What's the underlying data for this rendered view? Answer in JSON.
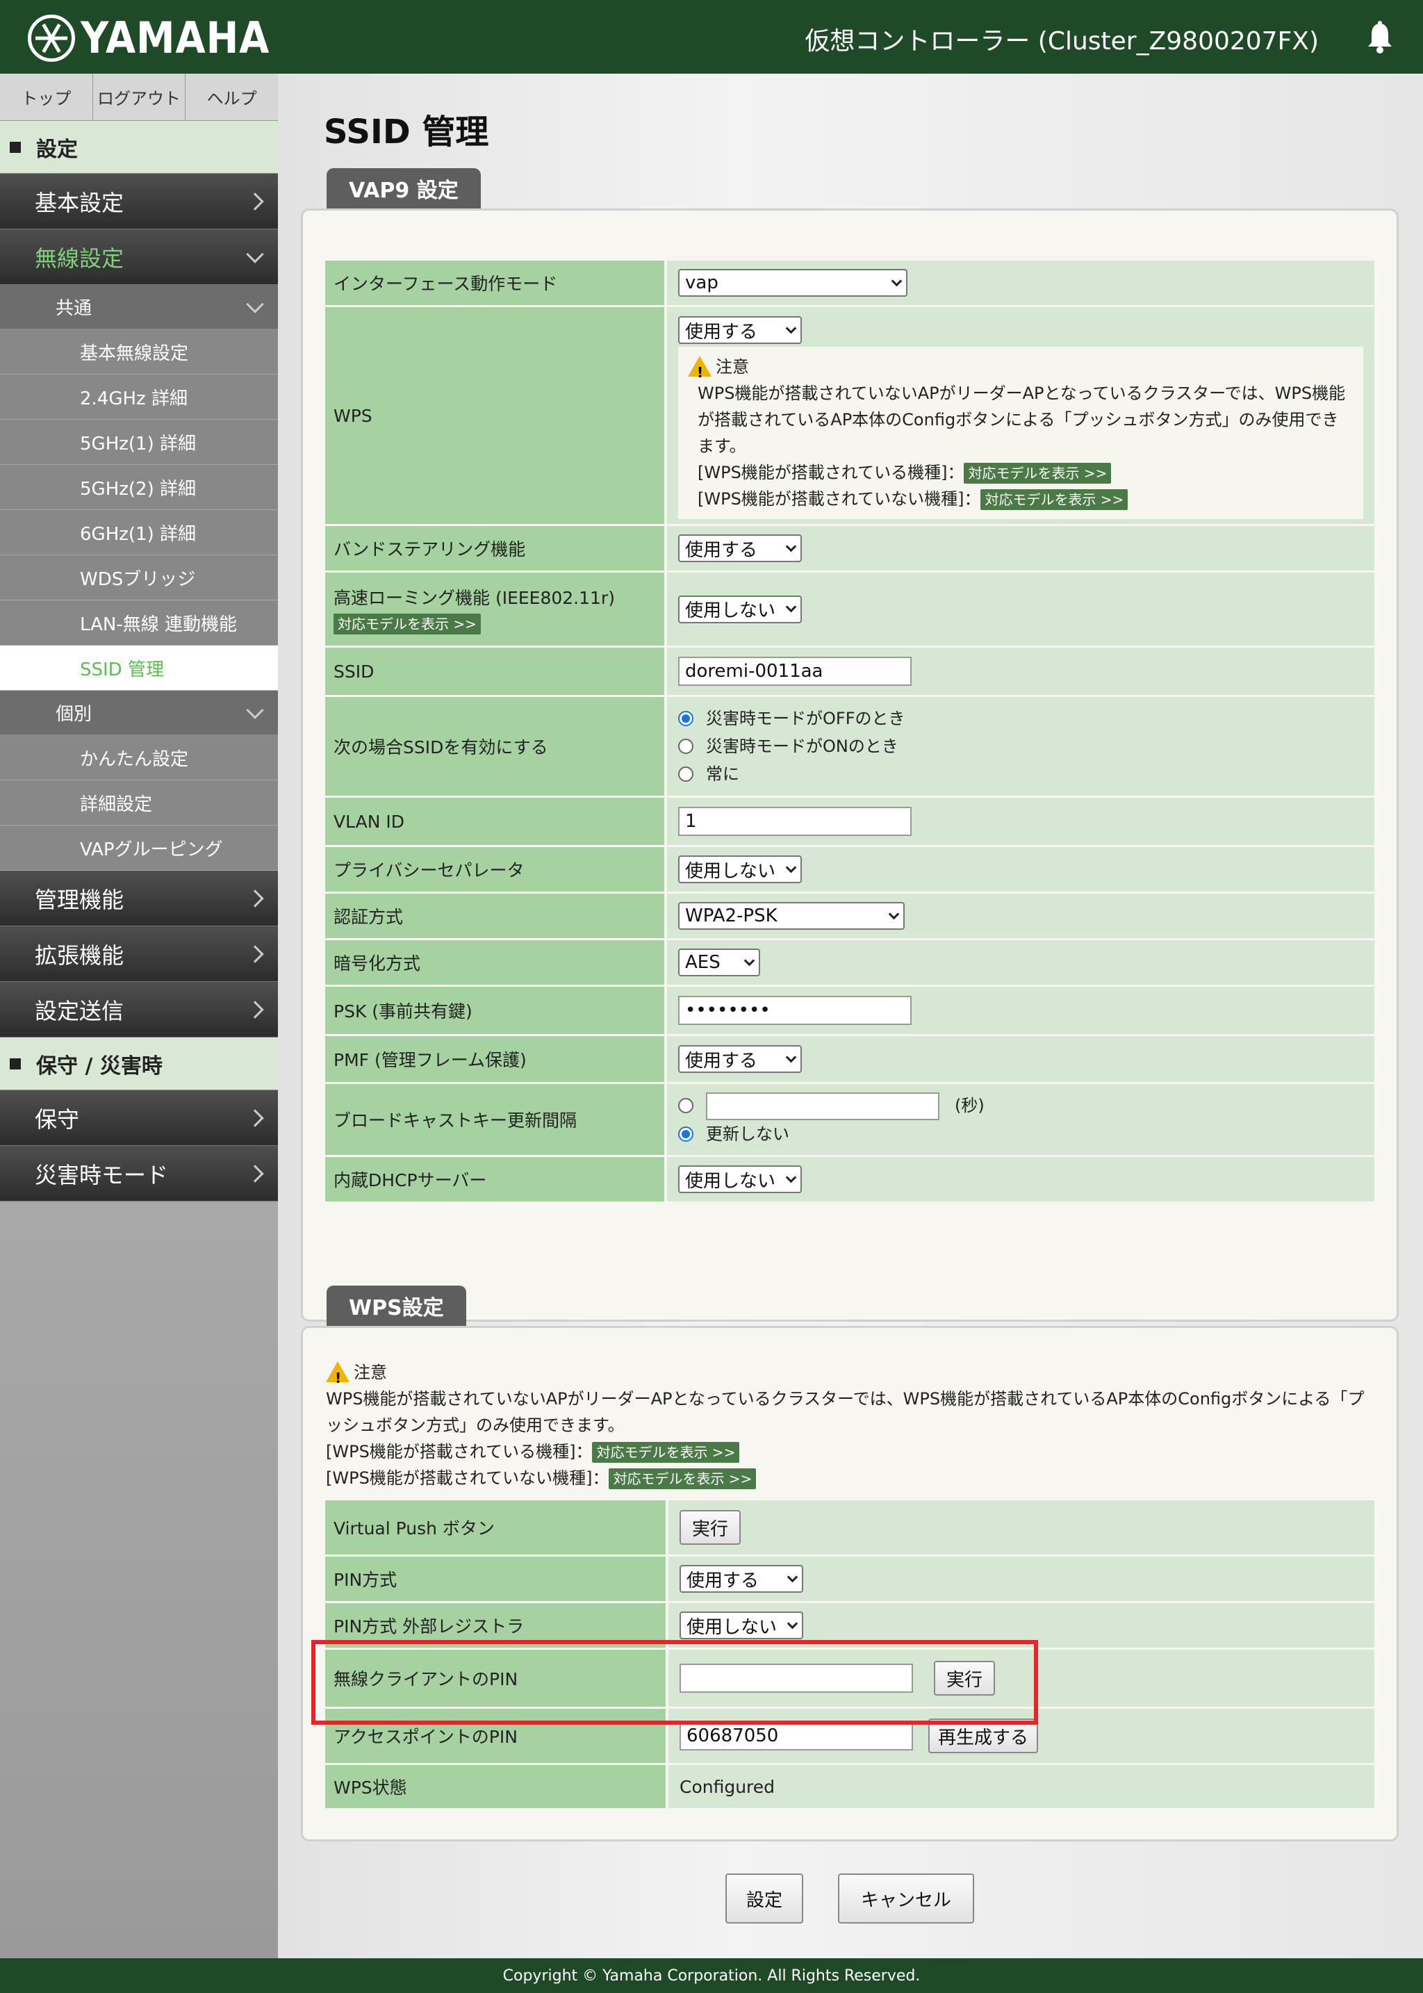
{
  "header": {
    "brand": "YAMAHA",
    "title": "仮想コントローラー (Cluster_Z9800207FX)"
  },
  "topnav": [
    "トップ",
    "ログアウト",
    "ヘルプ"
  ],
  "sidebar": {
    "section_settings": "設定",
    "basic": "基本設定",
    "wireless": "無線設定",
    "common": "共通",
    "common_items": [
      "基本無線設定",
      "2.4GHz 詳細",
      "5GHz(1) 詳細",
      "5GHz(2) 詳細",
      "6GHz(1) 詳細",
      "WDSブリッジ",
      "LAN-無線 連動機能",
      "SSID 管理"
    ],
    "individual": "個別",
    "individual_items": [
      "かんたん設定",
      "詳細設定",
      "VAPグルーピング"
    ],
    "management": "管理機能",
    "extension": "拡張機能",
    "send": "設定送信",
    "section_maintenance": "保守 / 災害時",
    "maintenance": "保守",
    "disaster": "災害時モード"
  },
  "page": {
    "title": "SSID 管理"
  },
  "vap": {
    "tab": "VAP9 設定",
    "mode_label": "インターフェース動作モード",
    "mode_value": "vap",
    "wps_label": "WPS",
    "wps_value": "使用する",
    "note_title": "注意",
    "note_body": "WPS機能が搭載されていないAPがリーダーAPとなっているクラスターでは、WPS機能が搭載されているAP本体のConfigボタンによる「プッシュボタン方式」のみ使用できます。",
    "note_with": "[WPS機能が搭載されている機種]：",
    "note_without": "[WPS機能が搭載されていない機種]：",
    "show_models": "対応モデルを表示 >>",
    "band_label": "バンドステアリング機能",
    "band_value": "使用する",
    "roam_label": "高速ローミング機能 (IEEE802.11r)",
    "roam_value": "使用しない",
    "ssid_label": "SSID",
    "ssid_value": "doremi-0011aa",
    "enable_label": "次の場合SSIDを有効にする",
    "enable_options": [
      "災害時モードがOFFのとき",
      "災害時モードがONのとき",
      "常に"
    ],
    "enable_selected": 0,
    "vlan_label": "VLAN ID",
    "vlan_value": "1",
    "privacy_label": "プライバシーセパレータ",
    "privacy_value": "使用しない",
    "auth_label": "認証方式",
    "auth_value": "WPA2-PSK",
    "enc_label": "暗号化方式",
    "enc_value": "AES",
    "psk_label": "PSK (事前共有鍵)",
    "psk_value": "••••••••",
    "pmf_label": "PMF (管理フレーム保護)",
    "pmf_value": "使用する",
    "bcast_label": "ブロードキャストキー更新間隔",
    "bcast_unit": "(秒)",
    "bcast_none": "更新しない",
    "dhcp_label": "内蔵DHCPサーバー",
    "dhcp_value": "使用しない"
  },
  "wps": {
    "tab": "WPS設定",
    "note_title": "注意",
    "note_body": "WPS機能が搭載されていないAPがリーダーAPとなっているクラスターでは、WPS機能が搭載されているAP本体のConfigボタンによる「プッシュボタン方式」のみ使用できます。",
    "note_with": "[WPS機能が搭載されている機種]：",
    "note_without": "[WPS機能が搭載されていない機種]：",
    "show_models": "対応モデルを表示 >>",
    "vpush_label": "Virtual Push ボタン",
    "execute": "実行",
    "pin_label": "PIN方式",
    "pin_value": "使用する",
    "registrar_label": "PIN方式 外部レジストラ",
    "registrar_value": "使用しない",
    "client_pin_label": "無線クライアントのPIN",
    "client_pin_value": "",
    "ap_pin_label": "アクセスポイントのPIN",
    "ap_pin_value": "60687050",
    "regenerate": "再生成する",
    "state_label": "WPS状態",
    "state_value": "Configured"
  },
  "actions": {
    "submit": "設定",
    "cancel": "キャンセル"
  },
  "footer": "Copyright © Yamaha Corporation. All Rights Reserved."
}
